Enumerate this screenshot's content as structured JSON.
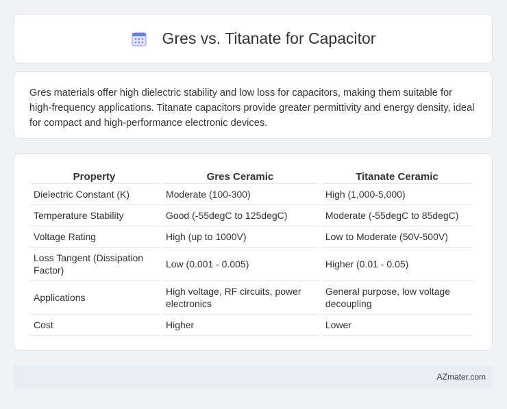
{
  "header": {
    "title": "Gres vs. Titanate for Capacitor",
    "icon": "calendar-icon"
  },
  "summary": {
    "text": "Gres materials offer high dielectric stability and low loss for capacitors, making them suitable for high-frequency applications. Titanate capacitors provide greater permittivity and energy density, ideal for compact and high-performance electronic devices."
  },
  "table": {
    "headers": [
      "Property",
      "Gres Ceramic",
      "Titanate Ceramic"
    ],
    "rows": [
      [
        "Dielectric Constant (K)",
        "Moderate (100-300)",
        "High (1,000-5,000)"
      ],
      [
        "Temperature Stability",
        "Good (-55degC to 125degC)",
        "Moderate (-55degC to 85degC)"
      ],
      [
        "Voltage Rating",
        "High (up to 1000V)",
        "Low to Moderate (50V-500V)"
      ],
      [
        "Loss Tangent (Dissipation Factor)",
        "Low (0.001 - 0.005)",
        "Higher (0.01 - 0.05)"
      ],
      [
        "Applications",
        "High voltage, RF circuits, power electronics",
        "General purpose, low voltage decoupling"
      ],
      [
        "Cost",
        "Higher",
        "Lower"
      ]
    ]
  },
  "footer": {
    "brand": "AZmater.com"
  },
  "colors": {
    "icon_primary": "#6b7fd7",
    "icon_accent": "#e57373",
    "footer_bg": "#e8eef6"
  }
}
